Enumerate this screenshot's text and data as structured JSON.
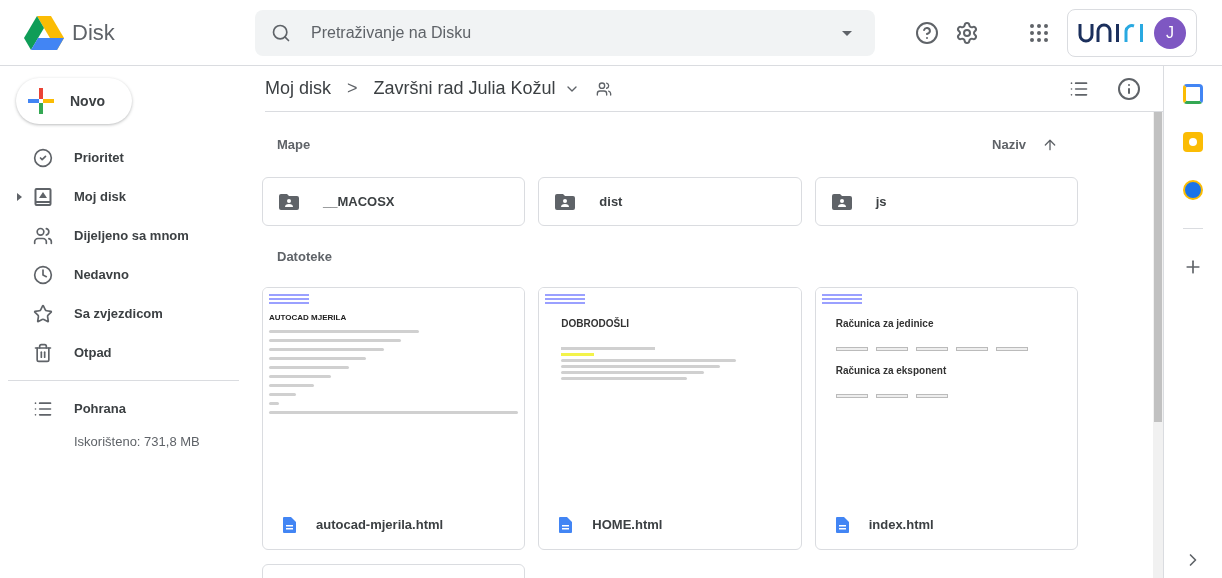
{
  "app": {
    "name": "Disk"
  },
  "search": {
    "placeholder": "Pretraživanje na Disku"
  },
  "new_button": "Novo",
  "sidebar": {
    "items": [
      {
        "label": "Prioritet",
        "kind": "priority",
        "expandable": false
      },
      {
        "label": "Moj disk",
        "kind": "drive",
        "expandable": true
      },
      {
        "label": "Dijeljeno sa mnom",
        "kind": "shared",
        "expandable": false
      },
      {
        "label": "Nedavno",
        "kind": "recent",
        "expandable": false
      },
      {
        "label": "Sa zvjezdicom",
        "kind": "starred",
        "expandable": false
      },
      {
        "label": "Otpad",
        "kind": "trash",
        "expandable": false
      }
    ],
    "storage": {
      "label": "Pohrana",
      "usage": "Iskorišteno: 731,8 MB"
    }
  },
  "account": {
    "avatar": "J"
  },
  "breadcrumb": {
    "root": "Moj disk",
    "separator": ">",
    "current": "Završni rad Julia Kožul"
  },
  "folders_section": {
    "title": "Mape",
    "sort": "Naziv"
  },
  "folders": [
    {
      "name": "__MACOSX"
    },
    {
      "name": "dist"
    },
    {
      "name": "js"
    }
  ],
  "files_section": {
    "title": "Datoteke"
  },
  "files": [
    {
      "name": "autocad-mjerila.html",
      "kind": "form",
      "headings": [
        "AUTOCAD MJERILA"
      ]
    },
    {
      "name": "HOME.html",
      "kind": "welcome",
      "headings": [
        "DOBRODOŠLI"
      ]
    },
    {
      "name": "index.html",
      "kind": "calc",
      "headings": [
        "Računica za jedinice",
        "Računica za eksponent"
      ]
    }
  ]
}
